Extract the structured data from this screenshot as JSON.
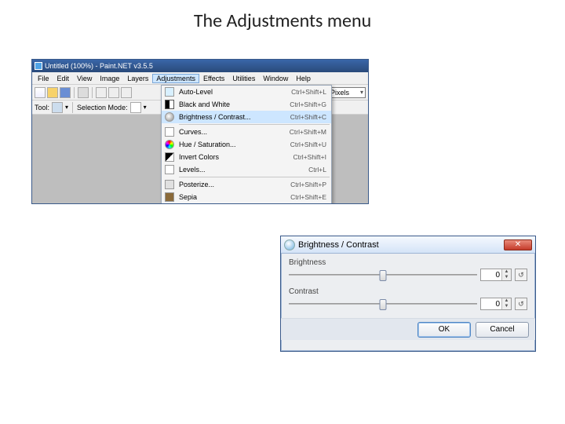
{
  "slide_title": "The Adjustments menu",
  "pnet": {
    "window_title": "Untitled (100%) - Paint.NET v3.5.5",
    "menubar": [
      "File",
      "Edit",
      "View",
      "Image",
      "Layers",
      "Adjustments",
      "Effects",
      "Utilities",
      "Window",
      "Help"
    ],
    "active_menu_index": 5,
    "toolbar_right_label": "Pixels",
    "toolrow2": {
      "tool_label": "Tool:",
      "selmode_label": "Selection Mode:"
    },
    "dropdown": [
      {
        "label": "Auto-Level",
        "accel": "Ctrl+Shift+L",
        "icon": "auto"
      },
      {
        "label": "Black and White",
        "accel": "Ctrl+Shift+G",
        "icon": "bw"
      },
      {
        "label": "Brightness / Contrast...",
        "accel": "Ctrl+Shift+C",
        "icon": "bc",
        "highlight": true
      },
      {
        "sep": true
      },
      {
        "label": "Curves...",
        "accel": "Ctrl+Shift+M",
        "icon": "curves"
      },
      {
        "label": "Hue / Saturation...",
        "accel": "Ctrl+Shift+U",
        "icon": "hue"
      },
      {
        "label": "Invert Colors",
        "accel": "Ctrl+Shift+I",
        "icon": "invert"
      },
      {
        "label": "Levels...",
        "accel": "Ctrl+L",
        "icon": "levels"
      },
      {
        "sep": true
      },
      {
        "label": "Posterize...",
        "accel": "Ctrl+Shift+P",
        "icon": "poster"
      },
      {
        "label": "Sepia",
        "accel": "Ctrl+Shift+E",
        "icon": "sepia"
      }
    ]
  },
  "bcdlg": {
    "title": "Brightness / Contrast",
    "brightness_label": "Brightness",
    "contrast_label": "Contrast",
    "brightness_value": "0",
    "contrast_value": "0",
    "ok_label": "OK",
    "cancel_label": "Cancel",
    "close_glyph": "✕"
  }
}
